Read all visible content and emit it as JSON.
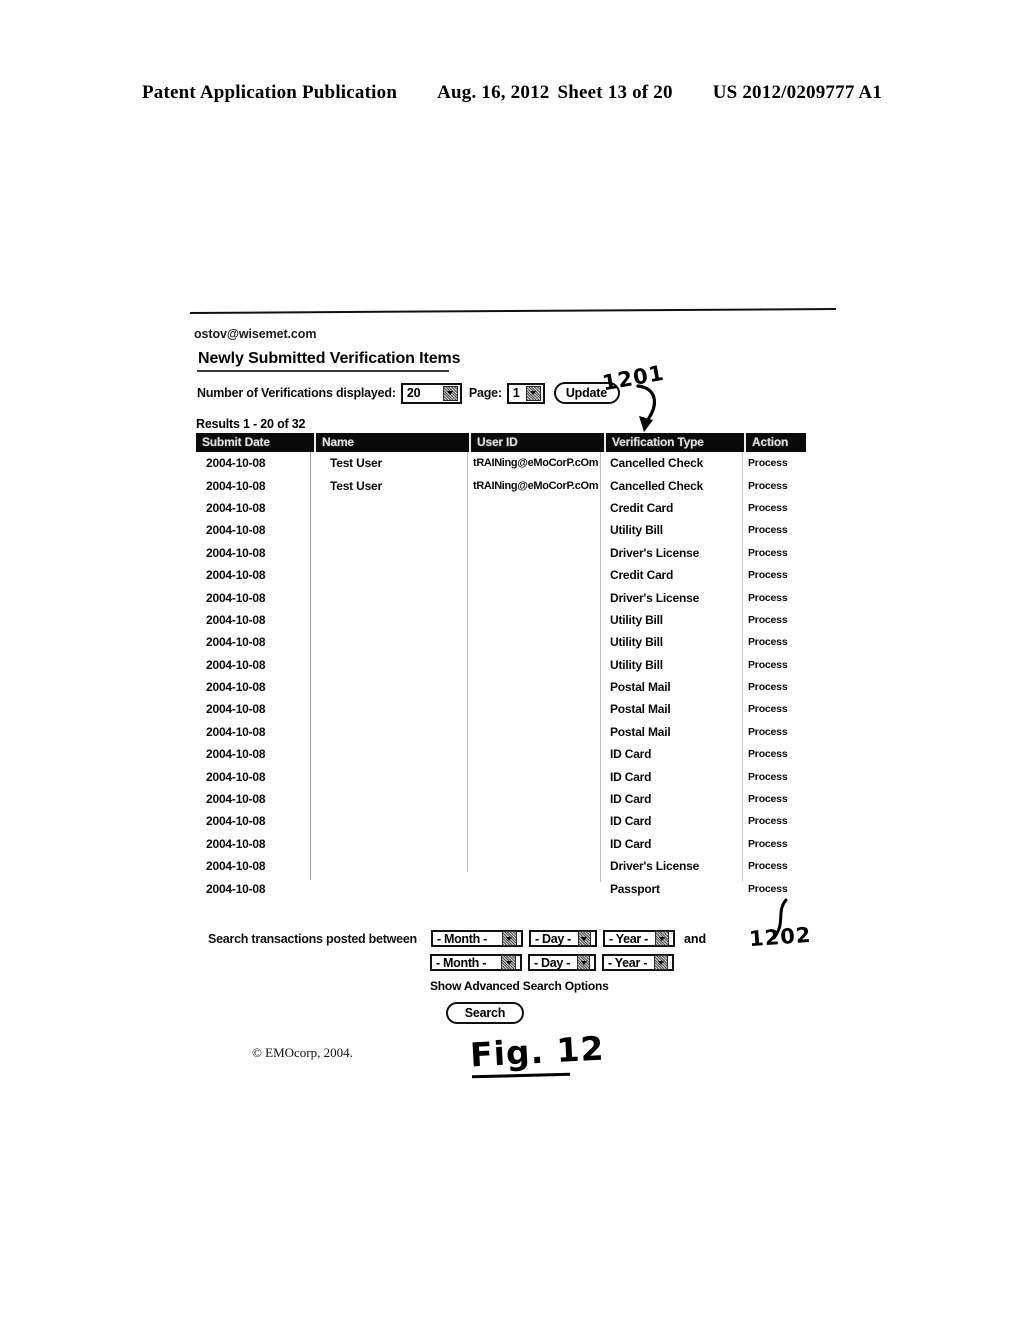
{
  "patent_header": {
    "publication": "Patent Application Publication",
    "date": "Aug. 16, 2012",
    "sheet": "Sheet 13 of 20",
    "number": "US 2012/0209777 A1"
  },
  "app": {
    "account_email": "ostov@wisemet.com",
    "page_title": "Newly Submitted Verification Items",
    "copyright": "© EMOcorp, 2004."
  },
  "controls": {
    "count_label": "Number of Verifications displayed:",
    "count_value": "20",
    "page_label": "Page:",
    "page_value": "1",
    "update_label": "Update",
    "results_summary": "Results 1 - 20 of 32"
  },
  "table": {
    "columns": [
      "Submit Date",
      "Name",
      "User ID",
      "Verification Type",
      "Action"
    ],
    "rows": [
      {
        "date": "2004-10-08",
        "name": "Test User",
        "user": "tRAINing@eMoCorP.cOm",
        "type": "Cancelled Check",
        "action": "Process"
      },
      {
        "date": "2004-10-08",
        "name": "Test User",
        "user": "tRAINing@eMoCorP.cOm",
        "type": "Cancelled Check",
        "action": "Process"
      },
      {
        "date": "2004-10-08",
        "name": "",
        "user": "",
        "type": "Credit Card",
        "action": "Process"
      },
      {
        "date": "2004-10-08",
        "name": "",
        "user": "",
        "type": "Utility Bill",
        "action": "Process"
      },
      {
        "date": "2004-10-08",
        "name": "",
        "user": "",
        "type": "Driver's License",
        "action": "Process"
      },
      {
        "date": "2004-10-08",
        "name": "",
        "user": "",
        "type": "Credit Card",
        "action": "Process"
      },
      {
        "date": "2004-10-08",
        "name": "",
        "user": "",
        "type": "Driver's License",
        "action": "Process"
      },
      {
        "date": "2004-10-08",
        "name": "",
        "user": "",
        "type": "Utility Bill",
        "action": "Process"
      },
      {
        "date": "2004-10-08",
        "name": "",
        "user": "",
        "type": "Utility Bill",
        "action": "Process"
      },
      {
        "date": "2004-10-08",
        "name": "",
        "user": "",
        "type": "Utility Bill",
        "action": "Process"
      },
      {
        "date": "2004-10-08",
        "name": "",
        "user": "",
        "type": "Postal Mail",
        "action": "Process"
      },
      {
        "date": "2004-10-08",
        "name": "",
        "user": "",
        "type": "Postal Mail",
        "action": "Process"
      },
      {
        "date": "2004-10-08",
        "name": "",
        "user": "",
        "type": "Postal Mail",
        "action": "Process"
      },
      {
        "date": "2004-10-08",
        "name": "",
        "user": "",
        "type": "ID Card",
        "action": "Process"
      },
      {
        "date": "2004-10-08",
        "name": "",
        "user": "",
        "type": "ID Card",
        "action": "Process"
      },
      {
        "date": "2004-10-08",
        "name": "",
        "user": "",
        "type": "ID Card",
        "action": "Process"
      },
      {
        "date": "2004-10-08",
        "name": "",
        "user": "",
        "type": "ID Card",
        "action": "Process"
      },
      {
        "date": "2004-10-08",
        "name": "",
        "user": "",
        "type": "ID Card",
        "action": "Process"
      },
      {
        "date": "2004-10-08",
        "name": "",
        "user": "",
        "type": "Driver's License",
        "action": "Process"
      },
      {
        "date": "2004-10-08",
        "name": "",
        "user": "",
        "type": "Passport",
        "action": "Process"
      }
    ]
  },
  "search": {
    "label": "Search transactions posted between",
    "and_word": "and",
    "from": {
      "month": "- Month -",
      "day": "- Day -",
      "year": "- Year -"
    },
    "to": {
      "month": "- Month -",
      "day": "- Day -",
      "year": "- Year -"
    },
    "advanced_link": "Show Advanced Search Options",
    "button_label": "Search"
  },
  "annotations": {
    "ref_1201": "1201",
    "ref_1202": "1202",
    "figure_label": "Fig. 12"
  }
}
